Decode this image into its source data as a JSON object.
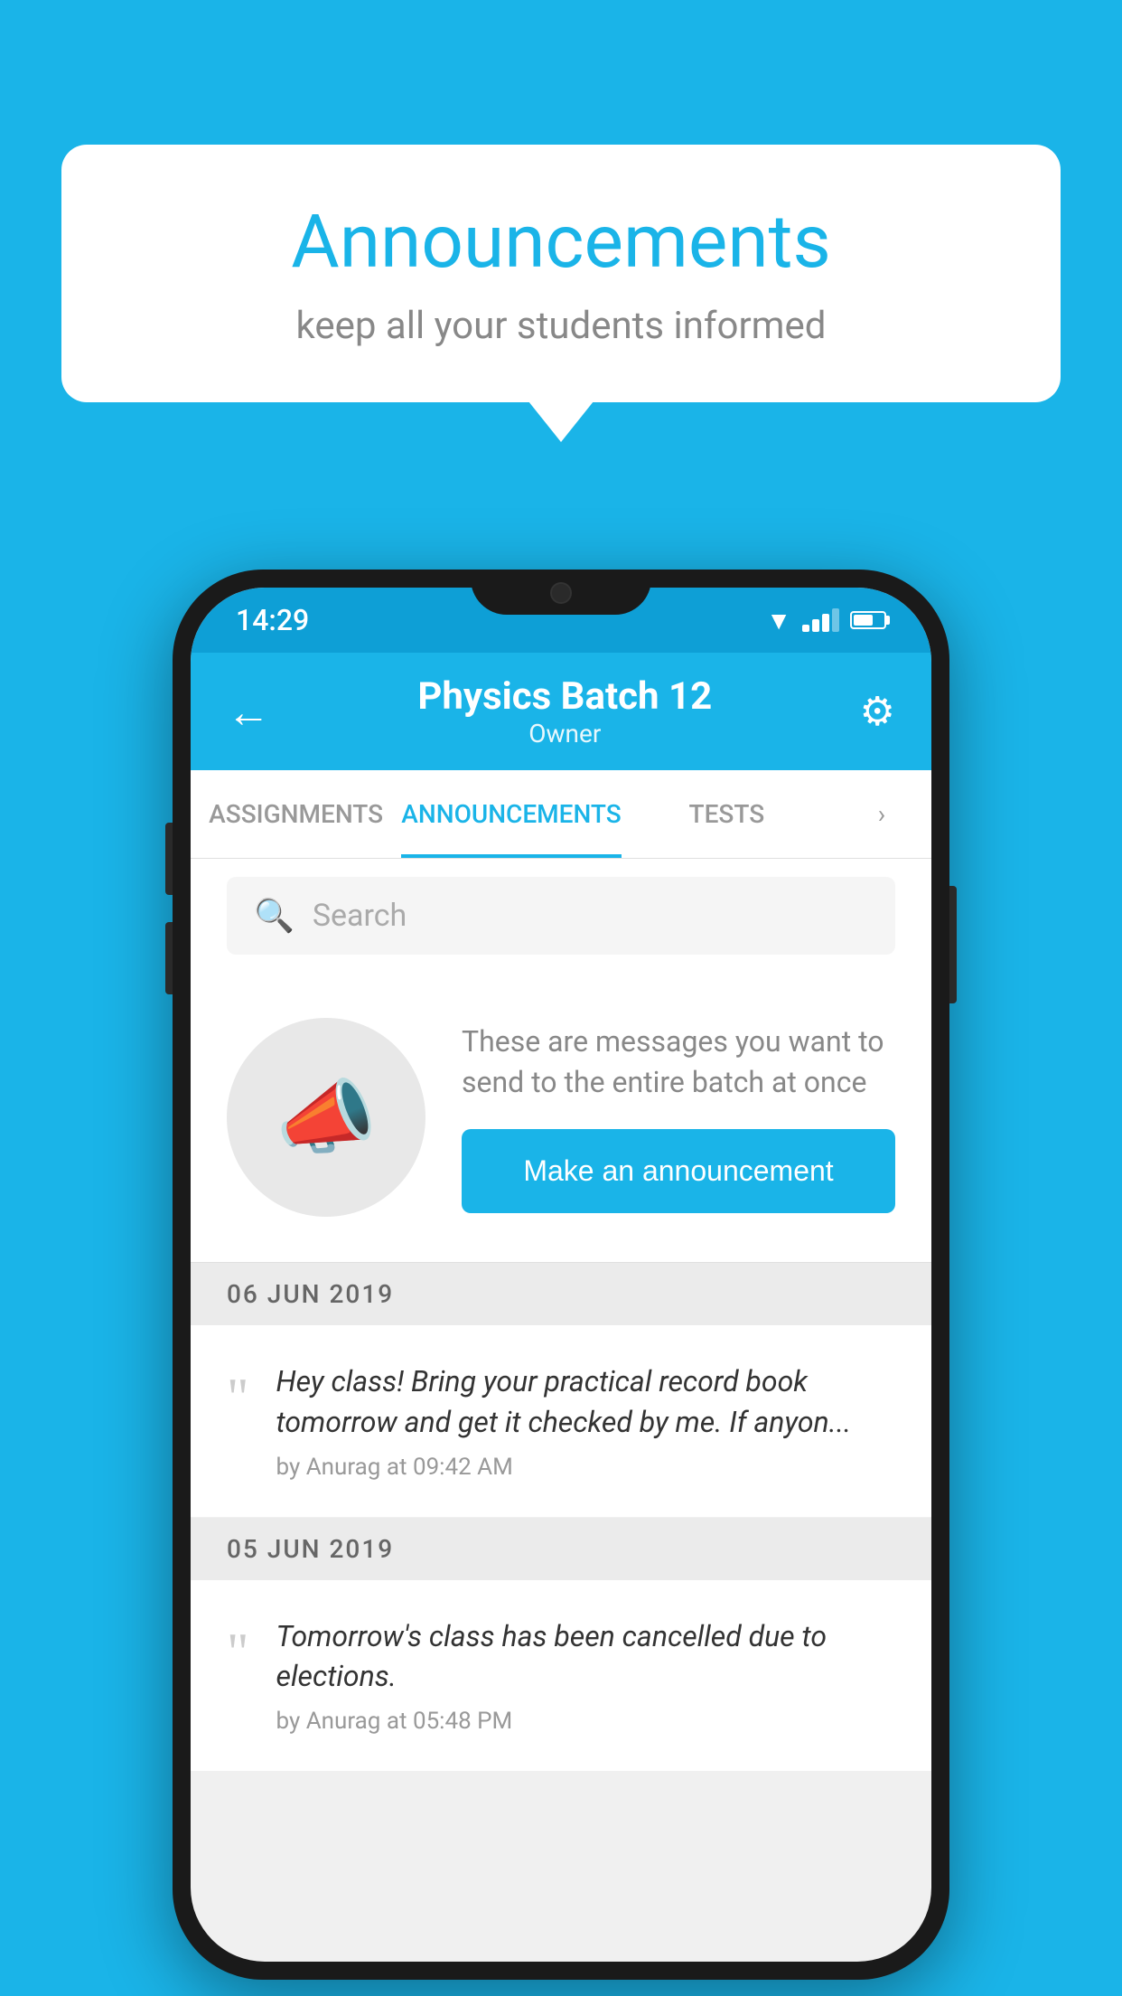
{
  "page": {
    "background_color": "#1ab4e8"
  },
  "speech_bubble": {
    "title": "Announcements",
    "subtitle": "keep all your students informed"
  },
  "phone": {
    "status_bar": {
      "time": "14:29"
    },
    "header": {
      "title": "Physics Batch 12",
      "subtitle": "Owner",
      "back_label": "←",
      "settings_label": "⚙"
    },
    "tabs": [
      {
        "label": "ASSIGNMENTS",
        "active": false
      },
      {
        "label": "ANNOUNCEMENTS",
        "active": true
      },
      {
        "label": "TESTS",
        "active": false
      }
    ],
    "search": {
      "placeholder": "Search"
    },
    "empty_state": {
      "description": "These are messages you want to send to the entire batch at once",
      "button_label": "Make an announcement"
    },
    "announcements": [
      {
        "date": "06  JUN  2019",
        "text": "Hey class! Bring your practical record book tomorrow and get it checked by me. If anyon...",
        "meta": "by Anurag at 09:42 AM"
      },
      {
        "date": "05  JUN  2019",
        "text": "Tomorrow's class has been cancelled due to elections.",
        "meta": "by Anurag at 05:48 PM"
      }
    ]
  }
}
